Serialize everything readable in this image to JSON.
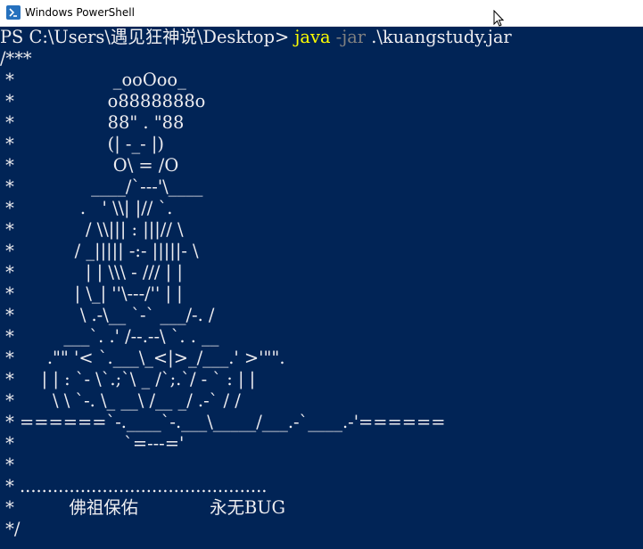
{
  "window": {
    "title": "Windows PowerShell",
    "icon": "powershell-icon",
    "background": "#012456",
    "foreground": "#eeedf0"
  },
  "prompt": {
    "text": "PS C:\\Users\\遇见狂神说\\Desktop> ",
    "executable": "java",
    "parameter": " -jar",
    "argument": " .\\kuangstudy.jar"
  },
  "output": [
    "/***",
    " *                  _ooOoo_",
    " *                 o8888888o",
    " *                 88\" . \"88",
    " *                 (| -_- |)",
    " *                  O\\ = /O",
    " *              ____/`---'\\____",
    " *            .   ' \\\\| |// `.",
    " *             / \\\\||| : |||// \\",
    " *           / _||||| -:- |||||- \\",
    " *             | | \\\\\\ - /// | |",
    " *           | \\_| ''\\---/'' | |",
    " *            \\ .-\\__ `-` ___/-. /",
    " *         ___`. .' /--.--\\ `. . __",
    " *      .\"\" '< `.___\\_<|>_/___.' >'\"\".",
    " *     | | : `- \\`.;`\\ _ /`;.`/ - ` : | |",
    " *       \\ \\ `-. \\_ __\\ /__ _/ .-` / /",
    " * ======`-.____`-.___\\_____/___.-`____.-'======",
    " *                    `=---='",
    " *",
    " * .............................................",
    " *          佛祖保佑             永无BUG",
    " */"
  ]
}
